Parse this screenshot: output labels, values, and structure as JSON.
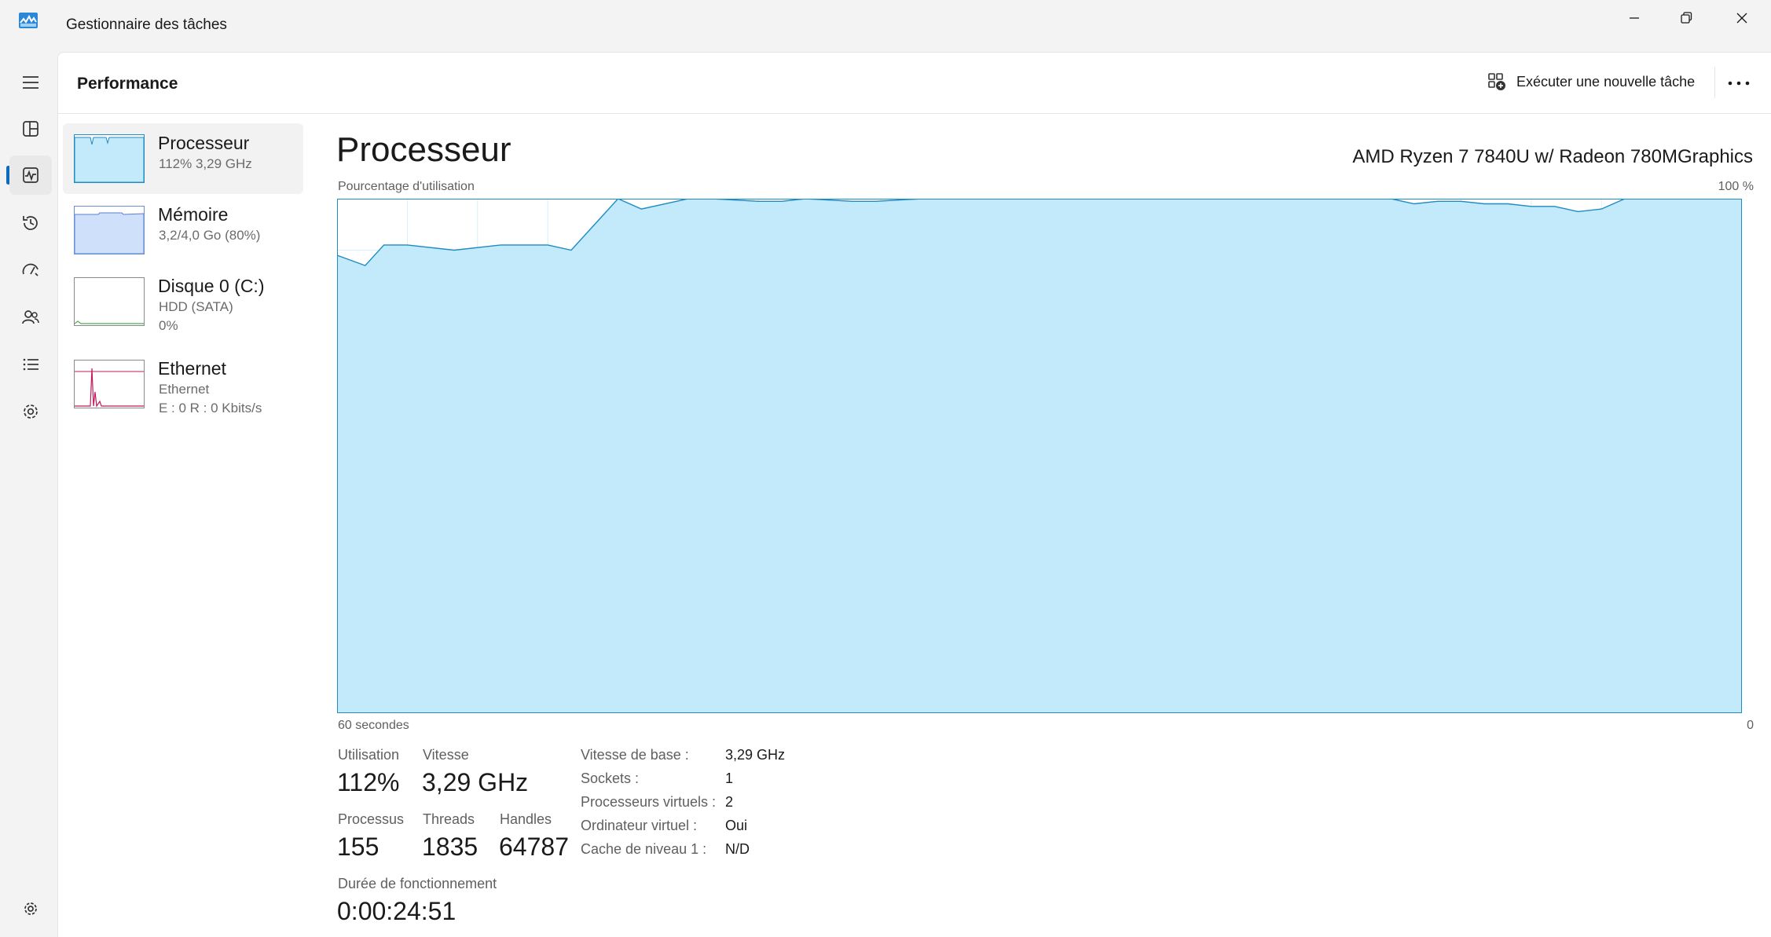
{
  "window": {
    "title": "Gestionnaire des tâches"
  },
  "header": {
    "title": "Performance",
    "run_new_task": "Exécuter une nouvelle tâche"
  },
  "devices": [
    {
      "name": "Processeur",
      "sub1": "112%  3,29 GHz"
    },
    {
      "name": "Mémoire",
      "sub1": "3,2/4,0 Go (80%)"
    },
    {
      "name": "Disque 0 (C:)",
      "sub1": "HDD (SATA)",
      "sub2": "0%"
    },
    {
      "name": "Ethernet",
      "sub1": "Ethernet",
      "sub2": "E : 0 R : 0 Kbits/s"
    }
  ],
  "detail": {
    "title": "Processeur",
    "cpu_model": "AMD Ryzen 7 7840U w/ Radeon 780MGraphics",
    "graph_label": "Pourcentage d'utilisation",
    "graph_max": "100 %",
    "time_window": "60 secondes",
    "time_end": "0",
    "stats": {
      "utilisation_label": "Utilisation",
      "utilisation_value": "112%",
      "vitesse_label": "Vitesse",
      "vitesse_value": "3,29 GHz",
      "processus_label": "Processus",
      "processus_value": "155",
      "threads_label": "Threads",
      "threads_value": "1835",
      "handles_label": "Handles",
      "handles_value": "64787",
      "uptime_label": "Durée de fonctionnement",
      "uptime_value": "0:00:24:51"
    },
    "specs": [
      {
        "label": "Vitesse de base :",
        "value": "3,29 GHz"
      },
      {
        "label": "Sockets :",
        "value": "1"
      },
      {
        "label": "Processeurs virtuels :",
        "value": "2"
      },
      {
        "label": "Ordinateur virtuel :",
        "value": "Oui"
      },
      {
        "label": "Cache de niveau 1 :",
        "value": "N/D"
      }
    ]
  },
  "colors": {
    "accent": "#0f6cbd",
    "cpu_fill": "#c2eafa",
    "cpu_line": "#1e8bc3",
    "mem_fill": "#cfe0fb",
    "ethernet_line": "#c2185b"
  },
  "chart_data": {
    "type": "area",
    "ylim": [
      0,
      100
    ],
    "xlim": [
      60,
      0
    ],
    "x": [
      60,
      58.8,
      58,
      57,
      55,
      53,
      51,
      50,
      48,
      47,
      45,
      44,
      42,
      41,
      40,
      38,
      37,
      35,
      34,
      33,
      32,
      31,
      30,
      29,
      27,
      26,
      25,
      24,
      23,
      22,
      21,
      20,
      19,
      17,
      16,
      15,
      14,
      13,
      12,
      11,
      10,
      9,
      8,
      7,
      6,
      5,
      4,
      3,
      2,
      1,
      0
    ],
    "values": [
      89,
      87,
      91,
      91,
      90,
      91,
      91,
      90,
      100,
      98,
      100,
      100,
      99.5,
      99.5,
      100,
      99.5,
      99.5,
      100,
      100,
      100,
      100,
      100,
      100,
      100,
      100,
      100,
      100,
      100,
      100,
      100,
      100,
      100,
      100,
      100,
      100,
      100,
      99,
      99.5,
      99.5,
      99,
      99,
      98.5,
      98.5,
      97.5,
      98,
      100,
      100,
      100,
      100,
      100,
      100
    ]
  }
}
